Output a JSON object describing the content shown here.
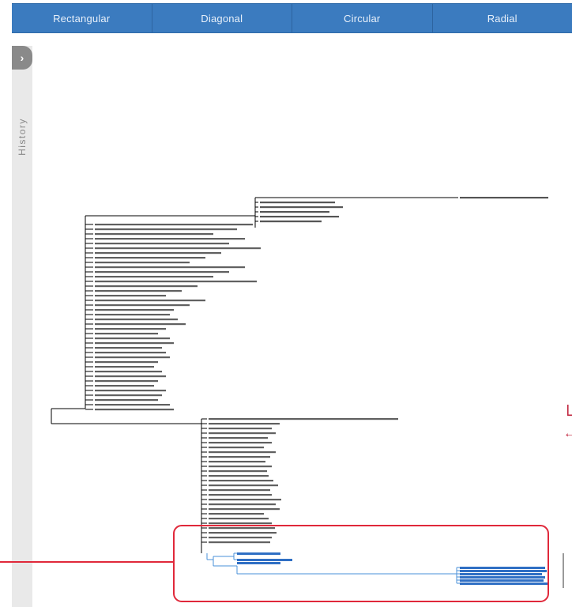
{
  "tabs": [
    "Rectangular",
    "Diagonal",
    "Circular",
    "Radial"
  ],
  "history": {
    "label": "History"
  },
  "colors": {
    "tab_bar": "#3b7bbf",
    "branch": "#000000",
    "highlight_branch": "#4a90d9",
    "highlight_label": "#2f6fc4",
    "selection_box": "#e0283a"
  },
  "side_marks": [
    "└",
    "←"
  ]
}
